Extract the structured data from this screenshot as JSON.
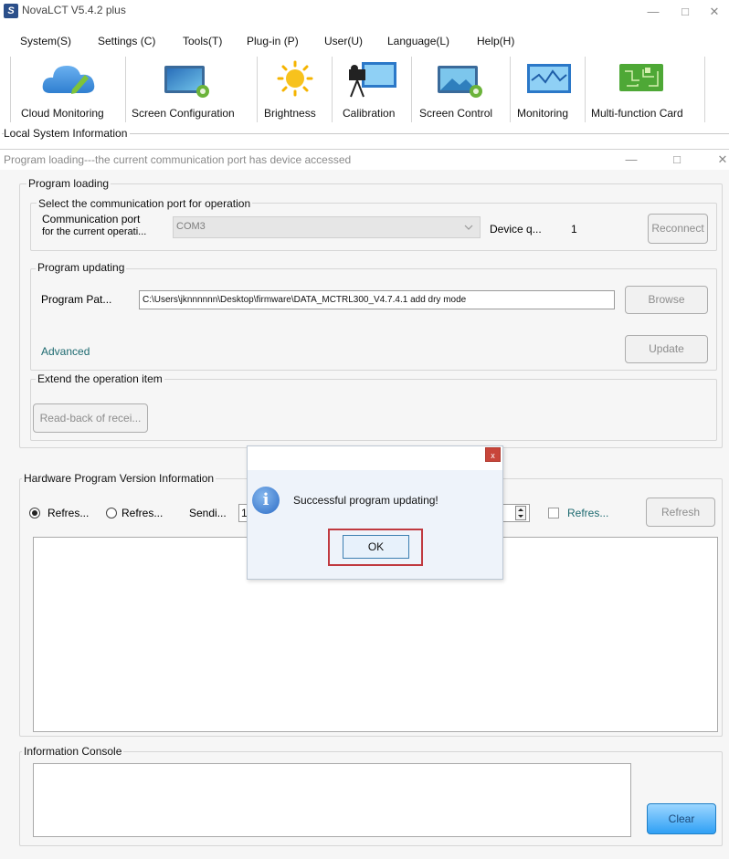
{
  "window": {
    "title": "NovaLCT V5.4.2 plus",
    "logo_letter": "S",
    "controls": {
      "minimize": "—",
      "maximize": "□",
      "close": "✕"
    }
  },
  "menu": [
    "System(S)",
    "Settings (C)",
    "Tools(T)",
    "Plug-in (P)",
    "User(U)",
    "Language(L)",
    "Help(H)"
  ],
  "toolbar": [
    {
      "label": "Cloud Monitoring",
      "icon": "cloud-icon"
    },
    {
      "label": "Screen Configuration",
      "icon": "screen-config-icon"
    },
    {
      "label": "Brightness",
      "icon": "sun-icon"
    },
    {
      "label": "Calibration",
      "icon": "camera-icon"
    },
    {
      "label": "Screen Control",
      "icon": "screen-control-icon"
    },
    {
      "label": "Monitoring",
      "icon": "monitor-wave-icon"
    },
    {
      "label": "Multi-function Card",
      "icon": "circuit-card-icon"
    }
  ],
  "local_system_label": "Local System Information",
  "inner_window": {
    "title": "Program loading---the current communication port has device accessed",
    "controls": {
      "minimize": "—",
      "maximize": "□",
      "close": "✕"
    }
  },
  "program_loading": {
    "legend": "Program loading",
    "select_port": {
      "legend": "Select the communication port for operation",
      "port_label_line1": "Communication port",
      "port_label_line2": "for the current operati...",
      "port_value": "COM3",
      "device_label": "Device q...",
      "device_count": "1",
      "reconnect_label": "Reconnect"
    },
    "program_updating": {
      "legend": "Program updating",
      "path_label": "Program Pat...",
      "path_value": "C:\\Users\\jknnnnnn\\Desktop\\firmware\\DATA_MCTRL300_V4.7.4.1 add dry mode",
      "browse_label": "Browse",
      "advanced_label": "Advanced",
      "update_label": "Update"
    },
    "extend": {
      "legend": "Extend the operation item",
      "readback_label": "Read-back of recei..."
    }
  },
  "hardware": {
    "legend": "Hardware Program Version Information",
    "radio1_label": "Refres...",
    "radio1_checked": true,
    "radio2_label": "Refres...",
    "radio2_checked": false,
    "sending_label": "Sendi...",
    "sending_value": "1",
    "checkbox_label": "Refres...",
    "refresh_label": "Refresh"
  },
  "console": {
    "legend": "Information Console",
    "clear_label": "Clear"
  },
  "dialog": {
    "close_glyph": "x",
    "info_glyph": "i",
    "message": "Successful program updating!",
    "ok_label": "OK"
  }
}
